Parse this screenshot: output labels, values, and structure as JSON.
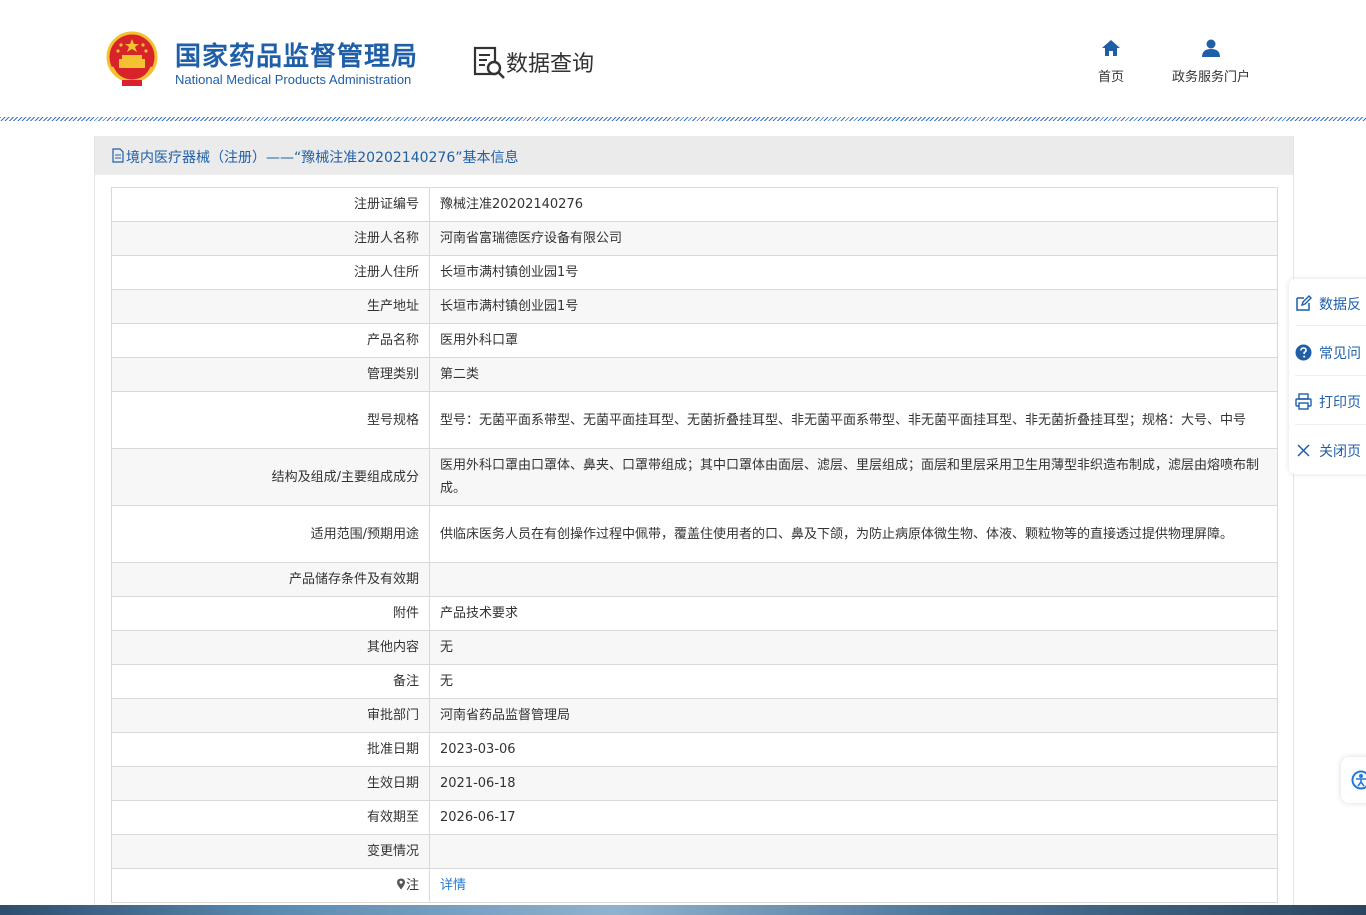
{
  "header": {
    "brand_cn": "国家药品监督管理局",
    "brand_en": "National Medical Products Administration",
    "section_title": "数据查询",
    "nav": [
      {
        "label": "首页",
        "icon": "home-icon"
      },
      {
        "label": "政务服务门户",
        "icon": "user-icon"
      }
    ]
  },
  "panel": {
    "title": "境内医疗器械（注册）——“豫械注准20202140276”基本信息",
    "rows": [
      {
        "label": "注册证编号",
        "value": "豫械注准20202140276"
      },
      {
        "label": "注册人名称",
        "value": "河南省富瑞德医疗设备有限公司"
      },
      {
        "label": "注册人住所",
        "value": "长垣市满村镇创业园1号"
      },
      {
        "label": "生产地址",
        "value": "长垣市满村镇创业园1号"
      },
      {
        "label": "产品名称",
        "value": "医用外科口罩"
      },
      {
        "label": "管理类别",
        "value": "第二类"
      },
      {
        "label": "型号规格",
        "value": "型号：无菌平面系带型、无菌平面挂耳型、无菌折叠挂耳型、非无菌平面系带型、非无菌平面挂耳型、非无菌折叠挂耳型；规格：大号、中号"
      },
      {
        "label": "结构及组成/主要组成成分",
        "value": "医用外科口罩由口罩体、鼻夹、口罩带组成；其中口罩体由面层、滤层、里层组成；面层和里层采用卫生用薄型非织造布制成，滤层由熔喷布制成。"
      },
      {
        "label": "适用范围/预期用途",
        "value": "供临床医务人员在有创操作过程中佩带，覆盖住使用者的口、鼻及下颌，为防止病原体微生物、体液、颗粒物等的直接透过提供物理屏障。"
      },
      {
        "label": "产品储存条件及有效期",
        "value": ""
      },
      {
        "label": "附件",
        "value": "产品技术要求"
      },
      {
        "label": "其他内容",
        "value": "无"
      },
      {
        "label": "备注",
        "value": "无"
      },
      {
        "label": "审批部门",
        "value": "河南省药品监督管理局"
      },
      {
        "label": "批准日期",
        "value": "2023-03-06"
      },
      {
        "label": "生效日期",
        "value": "2021-06-18"
      },
      {
        "label": "有效期至",
        "value": "2026-06-17"
      },
      {
        "label": "变更情况",
        "value": ""
      },
      {
        "label": "注",
        "value": "详情"
      }
    ]
  },
  "float_menu": [
    {
      "label": "数据反",
      "icon": "edit-icon"
    },
    {
      "label": "常见问",
      "icon": "help-circle-icon"
    },
    {
      "label": "打印页",
      "icon": "printer-icon"
    },
    {
      "label": "关闭页",
      "icon": "close-icon"
    }
  ],
  "colors": {
    "brand_blue": "#1f5fa8",
    "link_blue": "#1f7ad8",
    "row_alt": "#f7f7f7",
    "title_bar": "#ebebeb"
  }
}
